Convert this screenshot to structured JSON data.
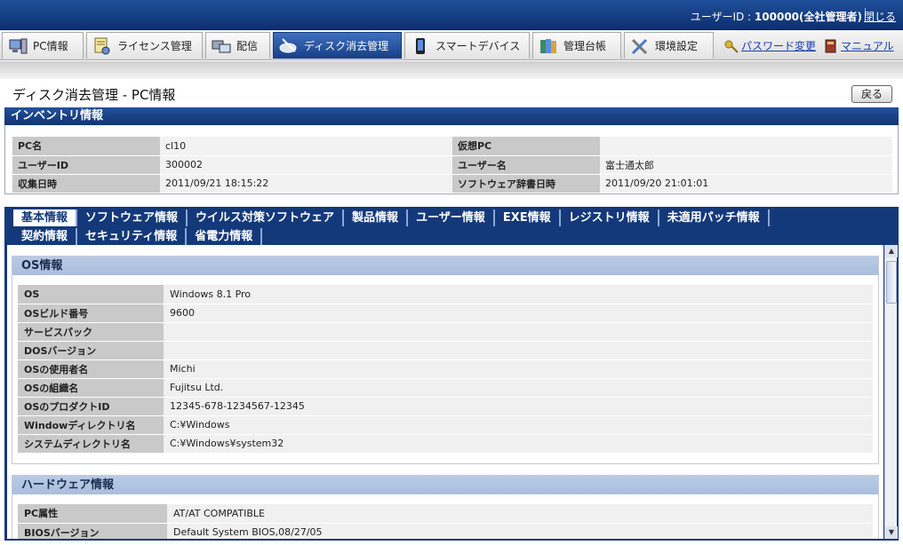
{
  "header": {
    "user_label": "ユーザーID :",
    "user_value": "100000(全社管理者)",
    "close_label": "閉じる"
  },
  "nav": {
    "tabs": [
      {
        "label": "PC情報",
        "icon": "pc-icon"
      },
      {
        "label": "ライセンス管理",
        "icon": "license-icon"
      },
      {
        "label": "配信",
        "icon": "delivery-icon"
      },
      {
        "label": "ディスク消去管理",
        "icon": "disk-erase-icon"
      },
      {
        "label": "スマートデバイス",
        "icon": "smart-device-icon"
      },
      {
        "label": "管理台帳",
        "icon": "ledger-icon"
      },
      {
        "label": "環境設定",
        "icon": "tools-icon"
      }
    ],
    "password_label": "パスワード変更",
    "manual_label": "マニュアル"
  },
  "page": {
    "title": "ディスク消去管理 - PC情報",
    "back_label": "戻る"
  },
  "inventory": {
    "title": "インベントリ情報",
    "rows": [
      {
        "l1": "PC名",
        "v1": "cl10",
        "l2": "仮想PC",
        "v2": ""
      },
      {
        "l1": "ユーザーID",
        "v1": "300002",
        "l2": "ユーザー名",
        "v2": "富士通太郎"
      },
      {
        "l1": "収集日時",
        "v1": "2011/09/21 18:15:22",
        "l2": "ソフトウェア辞書日時",
        "v2": "2011/09/20 21:01:01"
      }
    ]
  },
  "tabs": {
    "row1": [
      "基本情報",
      "ソフトウェア情報",
      "ウイルス対策ソフトウェア",
      "製品情報",
      "ユーザー情報",
      "EXE情報",
      "レジストリ情報",
      "未適用パッチ情報"
    ],
    "row2": [
      "契約情報",
      "セキュリティ情報",
      "省電力情報"
    ]
  },
  "os_info": {
    "title": "OS情報",
    "rows": [
      {
        "label": "OS",
        "value": "Windows 8.1 Pro"
      },
      {
        "label": "OSビルド番号",
        "value": "9600"
      },
      {
        "label": "サービスパック",
        "value": ""
      },
      {
        "label": "DOSバージョン",
        "value": ""
      },
      {
        "label": "OSの使用者名",
        "value": "Michi"
      },
      {
        "label": "OSの組織名",
        "value": "Fujitsu Ltd."
      },
      {
        "label": "OSのプロダクトID",
        "value": "12345-678-1234567-12345"
      },
      {
        "label": "Windowディレクトリ名",
        "value": "C:¥Windows"
      },
      {
        "label": "システムディレクトリ名",
        "value": "C:¥Windows¥system32"
      }
    ]
  },
  "hw_info": {
    "title": "ハードウェア情報",
    "rows": [
      {
        "label": "PC属性",
        "value": "AT/AT COMPATIBLE"
      },
      {
        "label": "BIOSバージョン",
        "value": "Default System BIOS,08/27/05"
      }
    ]
  }
}
